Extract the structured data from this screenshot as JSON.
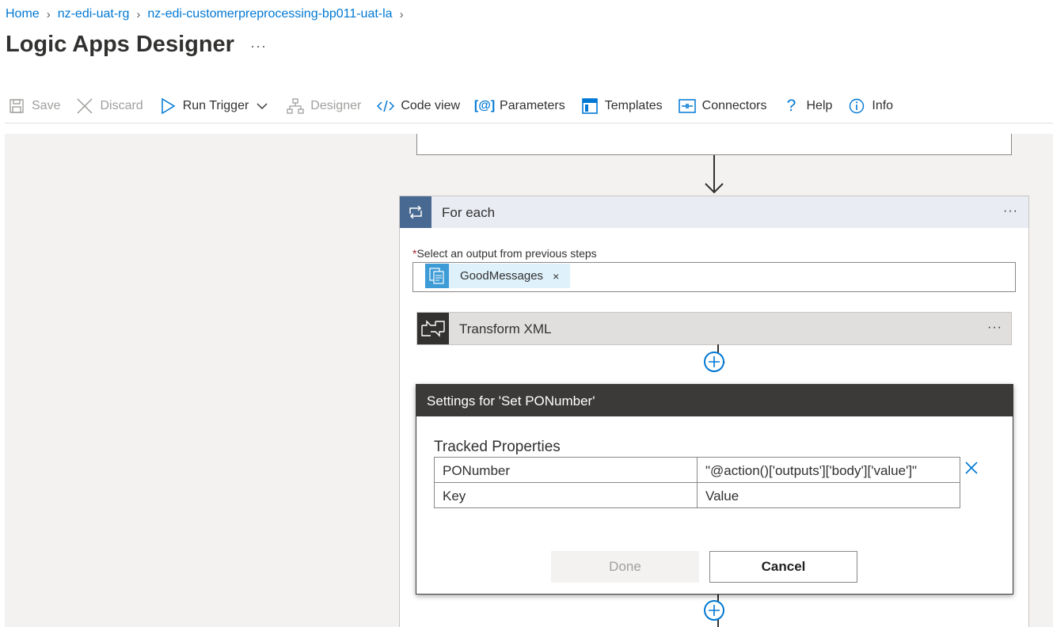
{
  "breadcrumb": {
    "items": [
      "Home",
      "nz-edi-uat-rg",
      "nz-edi-customerpreprocessing-bp011-uat-la"
    ]
  },
  "page": {
    "title": "Logic Apps Designer",
    "more": "···"
  },
  "toolbar": {
    "save": "Save",
    "discard": "Discard",
    "run_trigger": "Run Trigger",
    "designer": "Designer",
    "code_view": "Code view",
    "parameters": "Parameters",
    "templates": "Templates",
    "connectors": "Connectors",
    "help": "Help",
    "info": "Info"
  },
  "foreach": {
    "title": "For each",
    "more": "···",
    "select_label": "Select an output from previous steps",
    "required_mark": "*",
    "token": "GoodMessages",
    "token_remove": "×"
  },
  "transform": {
    "title": "Transform XML",
    "more": "···"
  },
  "settings": {
    "title": "Settings for 'Set PONumber'",
    "section": "Tracked Properties",
    "rows": [
      {
        "key": "PONumber",
        "value": "\"@action()['outputs']['body']['value']\""
      },
      {
        "key": "Key",
        "value": "Value"
      }
    ],
    "done": "Done",
    "cancel": "Cancel"
  },
  "colors": {
    "accent": "#0078d4",
    "foreach_header": "#486991",
    "dialog_header": "#3b3a39",
    "canvas": "#f3f2f1"
  },
  "icons": [
    "chevron-right-icon",
    "save-icon",
    "discard-icon",
    "play-icon",
    "chevron-down-icon",
    "designer-icon",
    "code-icon",
    "parameters-icon",
    "templates-icon",
    "connectors-icon",
    "help-icon",
    "info-icon",
    "loop-icon",
    "message-icon",
    "transform-icon",
    "plus-icon",
    "close-icon",
    "arrow-down-icon"
  ]
}
